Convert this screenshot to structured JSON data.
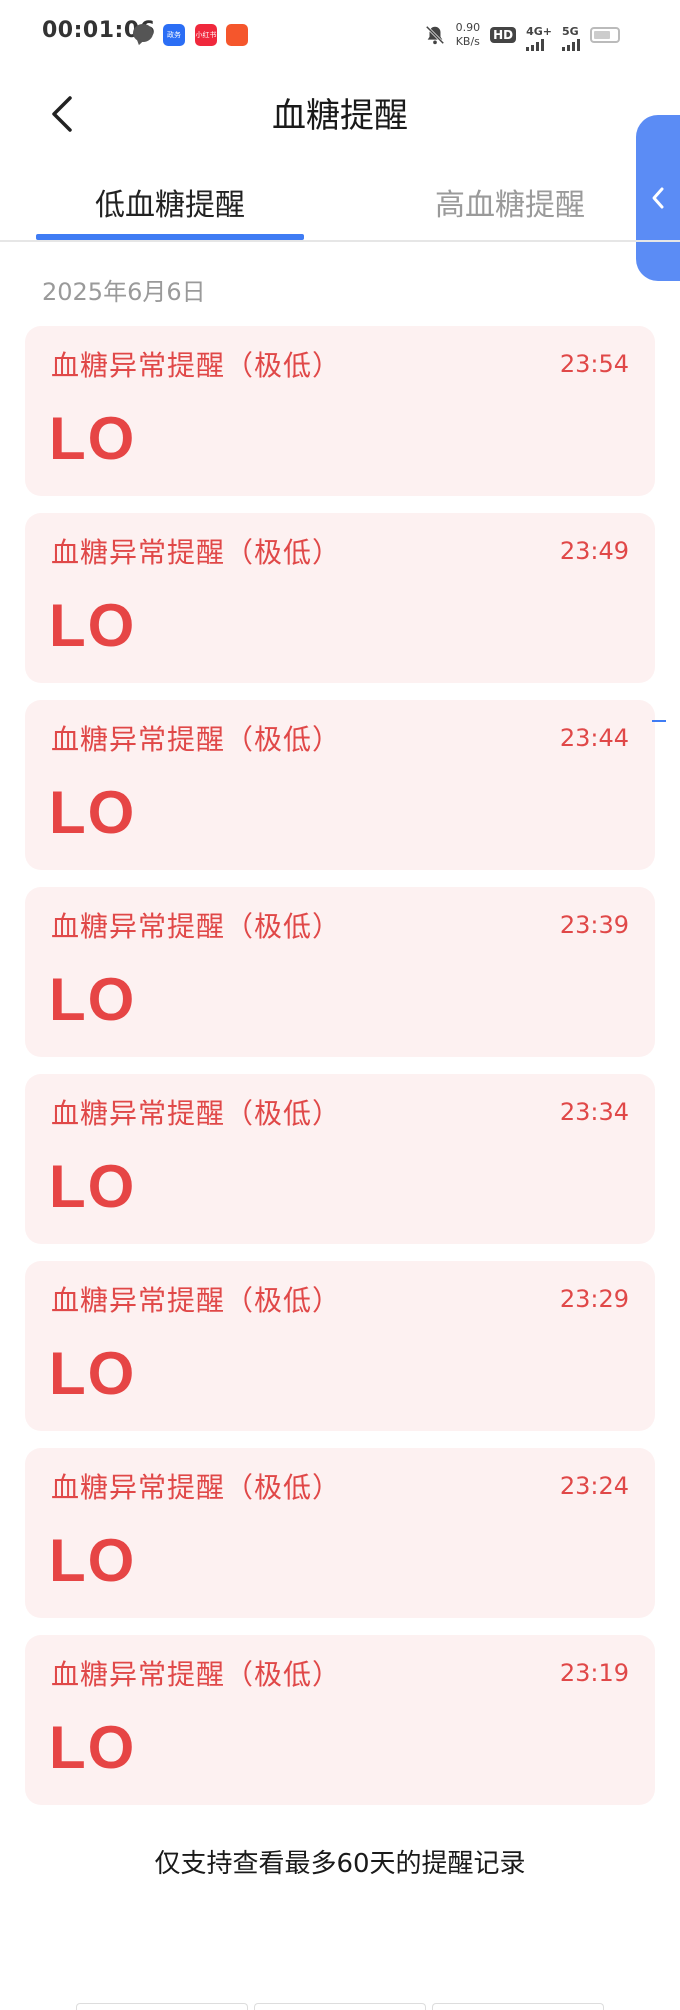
{
  "status_bar": {
    "time": "00:01:06",
    "app1": "政务",
    "app2": "小红书",
    "app3": "",
    "speed_value": "0.90",
    "speed_unit": "KB/s",
    "hd": "HD",
    "net1": "4G+",
    "net2": "5G"
  },
  "header": {
    "title": "血糖提醒"
  },
  "tabs": [
    {
      "label": "低血糖提醒",
      "active": true
    },
    {
      "label": "高血糖提醒",
      "active": false
    }
  ],
  "date": "2025年6月6日",
  "alerts": [
    {
      "title": "血糖异常提醒（极低）",
      "time": "23:54",
      "value": "LO"
    },
    {
      "title": "血糖异常提醒（极低）",
      "time": "23:49",
      "value": "LO"
    },
    {
      "title": "血糖异常提醒（极低）",
      "time": "23:44",
      "value": "LO"
    },
    {
      "title": "血糖异常提醒（极低）",
      "time": "23:39",
      "value": "LO"
    },
    {
      "title": "血糖异常提醒（极低）",
      "time": "23:34",
      "value": "LO"
    },
    {
      "title": "血糖异常提醒（极低）",
      "time": "23:29",
      "value": "LO"
    },
    {
      "title": "血糖异常提醒（极低）",
      "time": "23:24",
      "value": "LO"
    },
    {
      "title": "血糖异常提醒（极低）",
      "time": "23:19",
      "value": "LO"
    }
  ],
  "footer_note": "仅支持查看最多60天的提醒记录",
  "colors": {
    "accent": "#3f7cf4",
    "alert_text": "#e04848",
    "card_bg": "#fdf1f1",
    "handle": "#5b8cf5"
  }
}
